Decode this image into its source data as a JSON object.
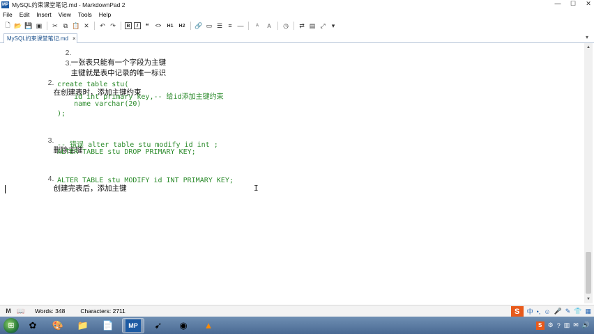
{
  "window": {
    "title": "MySQL约束课堂笔记.md - MarkdownPad 2",
    "app_icon_label": "MP",
    "controls": [
      "—",
      "☐",
      "✕"
    ]
  },
  "menu": [
    "File",
    "Edit",
    "Insert",
    "View",
    "Tools",
    "Help"
  ],
  "toolbar": {
    "bold": "B",
    "italic": "I",
    "code": "<>",
    "h1": "H1",
    "h2": "H2",
    "font_smaller": "A",
    "font_larger": "A"
  },
  "tab": {
    "label": "MySQL约束课堂笔记.md",
    "close": "×",
    "dropdown": "▾"
  },
  "editor": {
    "lines": [
      {
        "num": "2.",
        "text": "一张表只能有一个字段为主键"
      },
      {
        "num": "3.",
        "text": "主键就是表中记录的唯一标识"
      },
      {
        "num": "2.",
        "text": "在创建表时，添加主键约束"
      },
      {
        "code": "create table stu("
      },
      {
        "code": "    id int primary key,-- 给id添加主键约束"
      },
      {
        "code": "    name varchar(20)"
      },
      {
        "code": ");"
      },
      {
        "num": "3.",
        "text": "删除主键"
      },
      {
        "code": "-- 错误 alter table stu modify id int ;"
      },
      {
        "code": "ALTER TABLE stu DROP PRIMARY KEY;"
      },
      {
        "num": "4.",
        "text": "创建完表后，添加主键"
      },
      {
        "code": "ALTER TABLE stu MODIFY id INT PRIMARY KEY;"
      }
    ]
  },
  "statusbar": {
    "words": "Words: 348",
    "characters": "Characters: 2711",
    "ime": [
      "S",
      "中",
      "•,",
      "☺",
      "🎤"
    ]
  },
  "taskbar": {
    "mp_label": "MP",
    "items": [
      "start-orb",
      "app-a",
      "app-b",
      "explorer",
      "pdf",
      "markdownpad",
      "app-c",
      "chrome",
      "vlc"
    ]
  },
  "colors": {
    "code": "#2a8a2a",
    "tab_text": "#1a4f8b",
    "ime_brand": "#e85a1b"
  }
}
